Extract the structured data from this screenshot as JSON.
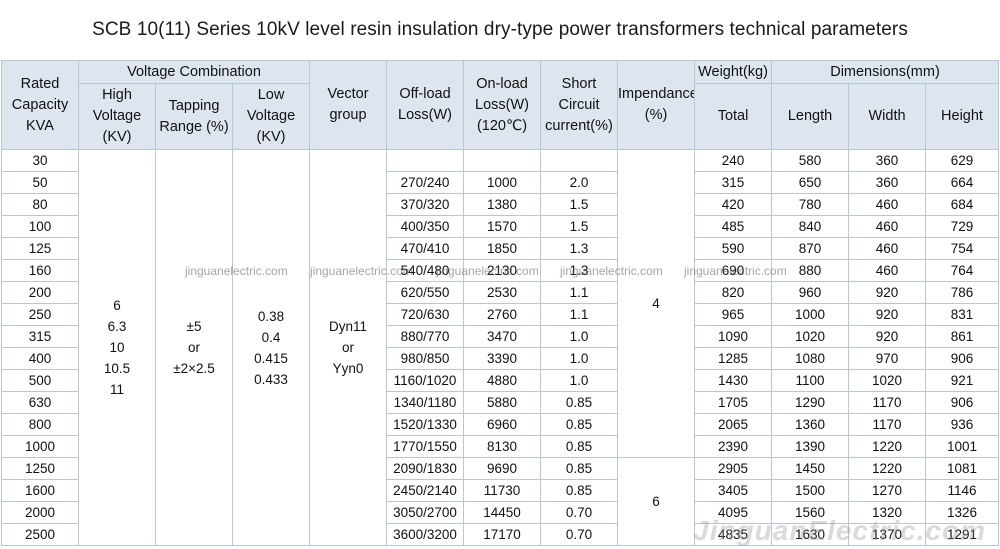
{
  "title": "SCB 10(11) Series 10kV level resin insulation dry-type power transformers technical parameters",
  "headers": {
    "rated_capacity": "Rated Capacity KVA",
    "voltage_combination": "Voltage Combination",
    "high_voltage": "High Voltage (KV)",
    "tapping_range": "Tapping Range (%)",
    "low_voltage": "Low Voltage (KV)",
    "vector_group": "Vector group",
    "offload_loss": "Off-load Loss(W)",
    "onload_loss": "On-load Loss(W) (120℃)",
    "short_circuit": "Short Circuit current(%)",
    "impedance": "Impendance (%)",
    "weight": "Weight(kg)",
    "weight_total": "Total",
    "dimensions": "Dimensions(mm)",
    "length": "Length",
    "width": "Width",
    "height": "Height"
  },
  "merged": {
    "high_voltage": [
      "6",
      "6.3",
      "10",
      "10.5",
      "11"
    ],
    "tapping_range": [
      "±5",
      "or",
      "±2×2.5"
    ],
    "low_voltage": [
      "0.38",
      "0.4",
      "0.415",
      "0.433"
    ],
    "vector_group": [
      "Dyn11",
      "or",
      "Yyn0"
    ],
    "impedance_a": "4",
    "impedance_b": "6"
  },
  "rows": [
    {
      "kva": "30",
      "offload": "",
      "onload": "",
      "sc": "",
      "weight": "240",
      "length": "580",
      "width": "360",
      "height": "629"
    },
    {
      "kva": "50",
      "offload": "270/240",
      "onload": "1000",
      "sc": "2.0",
      "weight": "315",
      "length": "650",
      "width": "360",
      "height": "664"
    },
    {
      "kva": "80",
      "offload": "370/320",
      "onload": "1380",
      "sc": "1.5",
      "weight": "420",
      "length": "780",
      "width": "460",
      "height": "684"
    },
    {
      "kva": "100",
      "offload": "400/350",
      "onload": "1570",
      "sc": "1.5",
      "weight": "485",
      "length": "840",
      "width": "460",
      "height": "729"
    },
    {
      "kva": "125",
      "offload": "470/410",
      "onload": "1850",
      "sc": "1.3",
      "weight": "590",
      "length": "870",
      "width": "460",
      "height": "754"
    },
    {
      "kva": "160",
      "offload": "540/480",
      "onload": "2130",
      "sc": "1.3",
      "weight": "690",
      "length": "880",
      "width": "460",
      "height": "764"
    },
    {
      "kva": "200",
      "offload": "620/550",
      "onload": "2530",
      "sc": "1.1",
      "weight": "820",
      "length": "960",
      "width": "920",
      "height": "786"
    },
    {
      "kva": "250",
      "offload": "720/630",
      "onload": "2760",
      "sc": "1.1",
      "weight": "965",
      "length": "1000",
      "width": "920",
      "height": "831"
    },
    {
      "kva": "315",
      "offload": "880/770",
      "onload": "3470",
      "sc": "1.0",
      "weight": "1090",
      "length": "1020",
      "width": "920",
      "height": "861"
    },
    {
      "kva": "400",
      "offload": "980/850",
      "onload": "3390",
      "sc": "1.0",
      "weight": "1285",
      "length": "1080",
      "width": "970",
      "height": "906"
    },
    {
      "kva": "500",
      "offload": "1160/1020",
      "onload": "4880",
      "sc": "1.0",
      "weight": "1430",
      "length": "1100",
      "width": "1020",
      "height": "921"
    },
    {
      "kva": "630",
      "offload": "1340/1180",
      "onload": "5880",
      "sc": "0.85",
      "weight": "1705",
      "length": "1290",
      "width": "1170",
      "height": "906"
    },
    {
      "kva": "800",
      "offload": "1520/1330",
      "onload": "6960",
      "sc": "0.85",
      "weight": "2065",
      "length": "1360",
      "width": "1170",
      "height": "936"
    },
    {
      "kva": "1000",
      "offload": "1770/1550",
      "onload": "8130",
      "sc": "0.85",
      "weight": "2390",
      "length": "1390",
      "width": "1220",
      "height": "1001"
    },
    {
      "kva": "1250",
      "offload": "2090/1830",
      "onload": "9690",
      "sc": "0.85",
      "weight": "2905",
      "length": "1450",
      "width": "1220",
      "height": "1081"
    },
    {
      "kva": "1600",
      "offload": "2450/2140",
      "onload": "11730",
      "sc": "0.85",
      "weight": "3405",
      "length": "1500",
      "width": "1270",
      "height": "1146"
    },
    {
      "kva": "2000",
      "offload": "3050/2700",
      "onload": "14450",
      "sc": "0.70",
      "weight": "4095",
      "length": "1560",
      "width": "1320",
      "height": "1326"
    },
    {
      "kva": "2500",
      "offload": "3600/3200",
      "onload": "17170",
      "sc": "0.70",
      "weight": "4835",
      "length": "1630",
      "width": "1370",
      "height": "1291"
    }
  ],
  "watermark_small": "jinguanelectric.com",
  "watermark_large": "JinguanElectric.com",
  "colors": {
    "header_bg": "#dde6ef",
    "border": "#b9c6d3"
  }
}
